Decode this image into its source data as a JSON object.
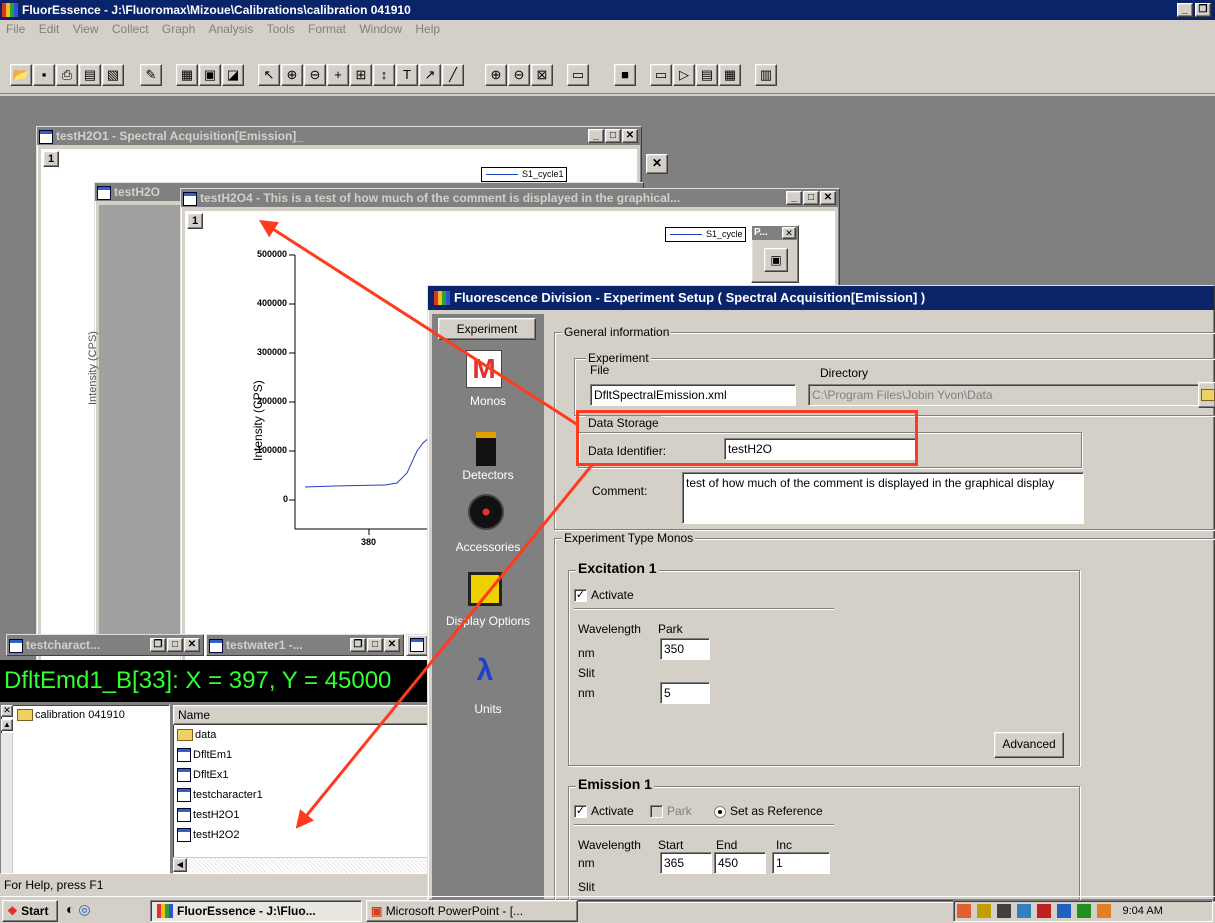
{
  "app": {
    "title": "FluorEssence - J:\\Fluoromax\\Mizoue\\Calibrations\\calibration 041910",
    "menu": [
      "File",
      "Edit",
      "View",
      "Collect",
      "Graph",
      "Analysis",
      "Tools",
      "Format",
      "Window",
      "Help"
    ]
  },
  "windows": {
    "w1_title": "testH2O1 - Spectral Acquisition[Emission]_",
    "w1_index": "1",
    "w1_legend": "S1_cycle1",
    "w2_title": "testH2O",
    "w3_title": "testH2O4 - This is a test of how much of the comment is displayed in the graphical...",
    "w3_index": "1",
    "w3_legend": "S1_cycle",
    "plot_ylabel": "Intensity (CPS)",
    "ghost_ylabel": "Intensity (CPS)",
    "yticks": [
      "500000",
      "400000",
      "300000",
      "200000",
      "100000",
      "0"
    ],
    "xtick": "380",
    "palette_title": "P..."
  },
  "minimized": {
    "m1": "testcharact...",
    "m2": "testwater1 -..."
  },
  "readout": "DfltEmd1_B[33]: X = 397, Y = 45000",
  "explorer": {
    "tree_root": "calibration 041910",
    "col_name": "Name",
    "items": [
      "data",
      "DfltEm1",
      "DfltEx1",
      "testcharacter1",
      "testH2O1",
      "testH2O2"
    ]
  },
  "dialog": {
    "title": "Fluorescence Division - Experiment Setup ( Spectral Acquisition[Emission] )",
    "sidebar": {
      "tab": "Experiment",
      "monos": "Monos",
      "detectors": "Detectors",
      "accessories": "Accessories",
      "display": "Display Options",
      "units": "Units"
    },
    "general": {
      "group": "General information",
      "experiment_group": "Experiment",
      "file_label": "File",
      "dir_label": "Directory",
      "file_value": "DfltSpectralEmission.xml",
      "dir_value": "C:\\Program Files\\Jobin Yvon\\Data",
      "storage_group": "Data Storage",
      "identifier_label": "Data Identifier:",
      "identifier_value": "testH2O",
      "comment_label": "Comment:",
      "comment_value": "test of how much of the comment is displayed in the graphical display"
    },
    "monos": {
      "group": "Experiment Type Monos",
      "ex_title": "Excitation 1",
      "ex_activate": "Activate",
      "wavelength": "Wavelength",
      "park": "Park",
      "nm": "nm",
      "park_value": "350",
      "slit": "Slit",
      "slit_value": "5",
      "advanced": "Advanced",
      "em_title": "Emission 1",
      "em_activate": "Activate",
      "em_park": "Park",
      "em_reference": "Set as Reference",
      "start": "Start",
      "end": "End",
      "inc": "Inc",
      "start_value": "365",
      "end_value": "450",
      "inc_value": "1"
    }
  },
  "statusbar": "For Help, press F1",
  "taskbar": {
    "start": "Start",
    "task1": "FluorEssence - J:\\Fluo...",
    "task2": "Microsoft PowerPoint - [...",
    "clock": "9:04 AM"
  },
  "colors": {
    "titlebar_active": "#0a246a",
    "face": "#d4d0c8",
    "mdi_bg": "#808080",
    "annotation": "#ff3b1f",
    "readout_text": "#33ff33",
    "series": "#2040c0"
  }
}
